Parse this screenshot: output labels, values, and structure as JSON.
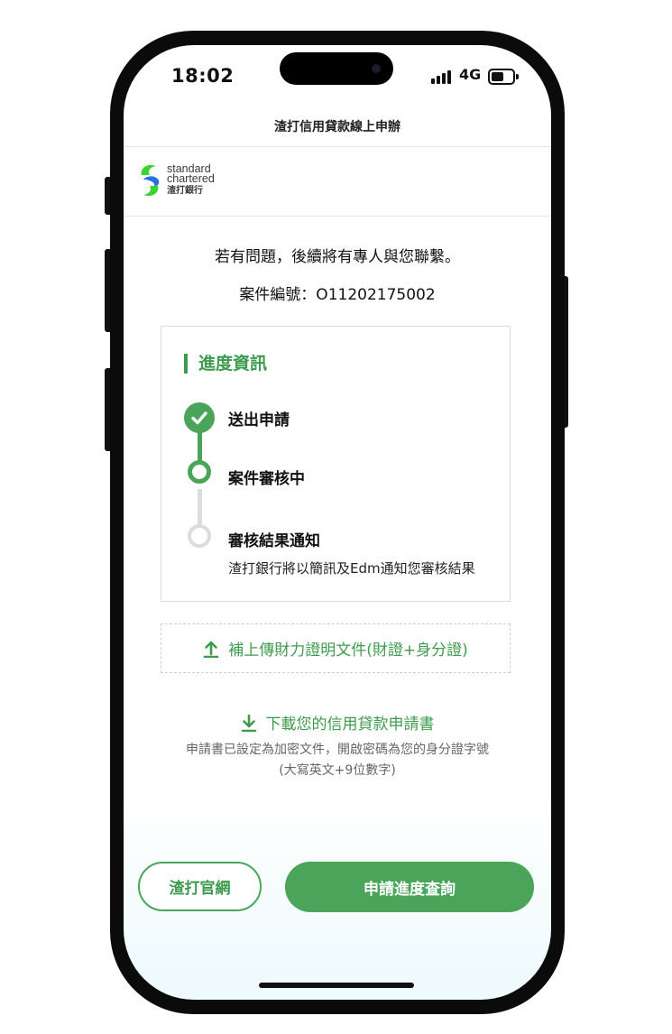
{
  "status_bar": {
    "time": "18:02",
    "network": "4G",
    "icons": [
      "signal-icon",
      "battery-icon"
    ]
  },
  "header": {
    "title": "渣打信用貸款線上申辦"
  },
  "brand": {
    "line1": "standard",
    "line2": "chartered",
    "line3": "渣打銀行",
    "colors": {
      "green": "#38d430",
      "blue": "#2f6ee0"
    }
  },
  "message": {
    "contact_note": "若有問題，後續將有專人與您聯繫。",
    "case_label": "案件編號：O11202175002"
  },
  "progress": {
    "title": "進度資訊",
    "steps": [
      {
        "label": "送出申請",
        "state": "done"
      },
      {
        "label": "案件審核中",
        "state": "current"
      },
      {
        "label": "審核結果通知",
        "state": "pending",
        "desc": "渣打銀行將以簡訊及Edm通知您審核結果"
      }
    ]
  },
  "upload": {
    "label": "補上傳財力證明文件(財證+身分證)",
    "icon": "upload-icon"
  },
  "download": {
    "label": "下載您的信用貸款申請書",
    "icon": "download-icon",
    "note_line1": "申請書已設定為加密文件，開啟密碼為您的身分證字號",
    "note_line2": "(大寫英文+9位數字)"
  },
  "footer": {
    "website_button": "渣打官網",
    "query_button": "申請進度查詢"
  },
  "colors": {
    "accent": "#4aa55a",
    "accent_text": "#3e9b4e",
    "pending": "#dcdcdc"
  }
}
